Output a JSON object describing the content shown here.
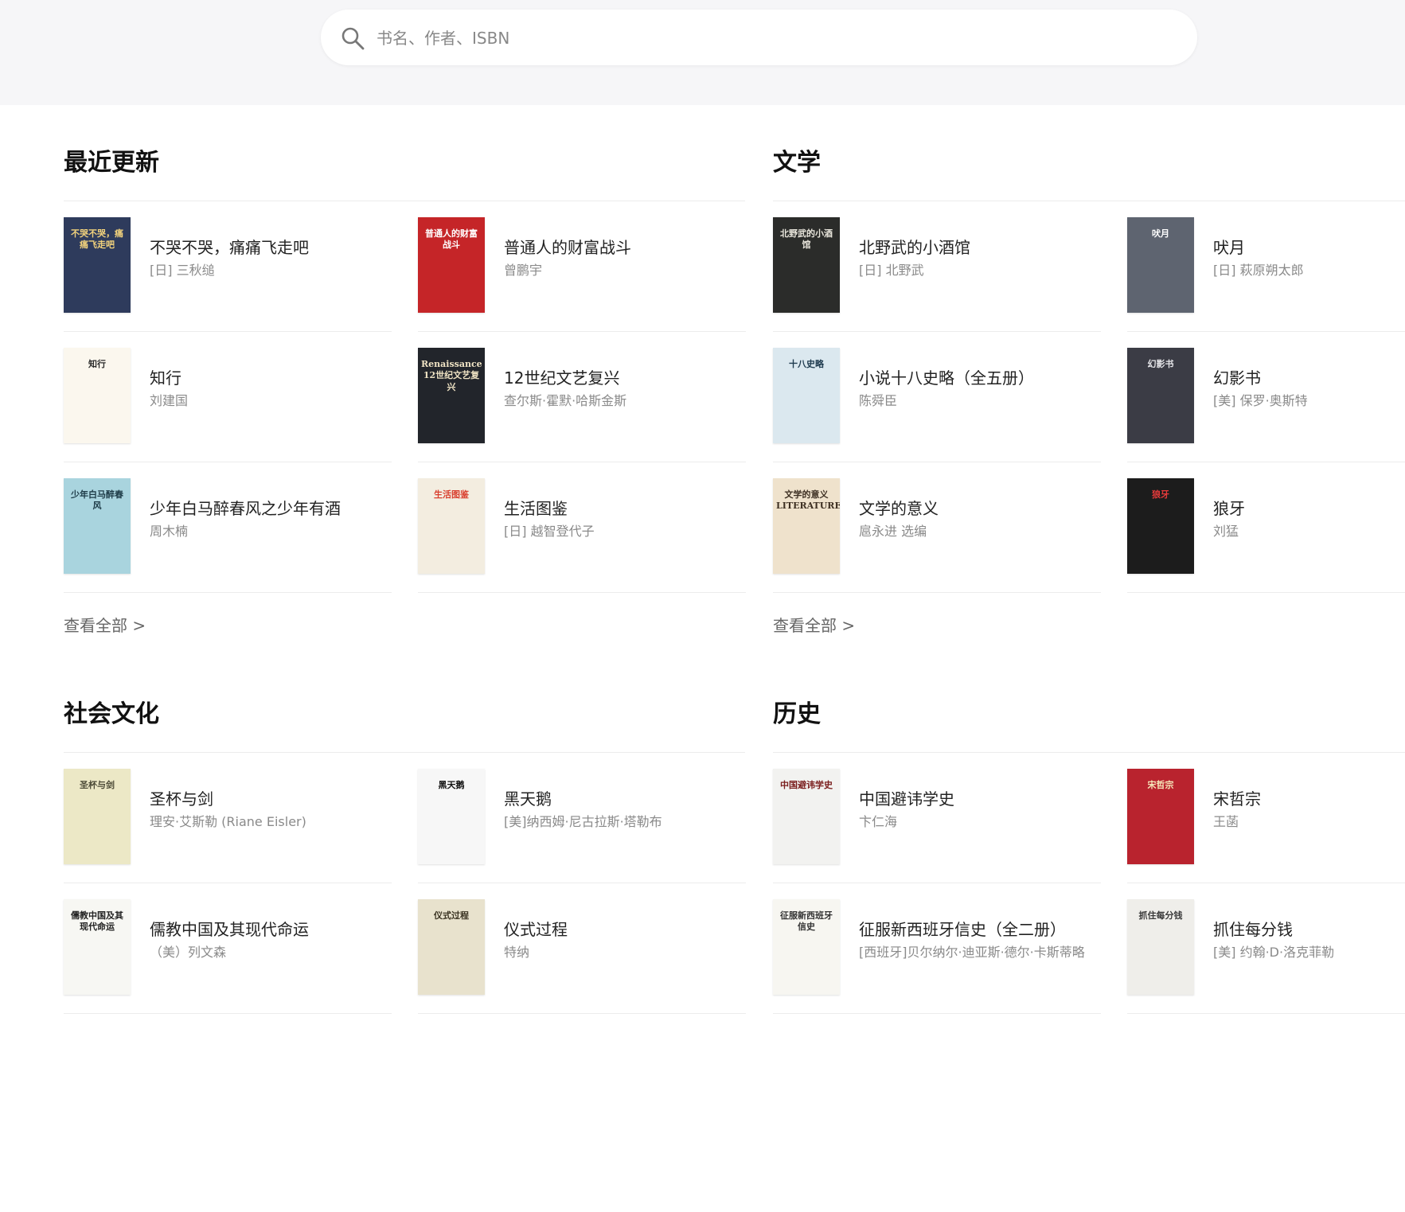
{
  "search": {
    "placeholder": "书名、作者、ISBN"
  },
  "sections": [
    {
      "title": "最近更新",
      "view_all": "查看全部 >",
      "books": [
        {
          "title": "不哭不哭，痛痛飞走吧",
          "author": "[日] 三秋缒",
          "cover_bg": "#2e3b5c",
          "cover_fg": "#f2d27c",
          "cover_text": "不哭不哭，痛痛飞走吧"
        },
        {
          "title": "普通人的财富战斗",
          "author": "曾鹏宇",
          "cover_bg": "#c52528",
          "cover_fg": "#ffffff",
          "cover_text": "普通人的财富战斗"
        },
        {
          "title": "知行",
          "author": "刘建国",
          "cover_bg": "#fbf7ee",
          "cover_fg": "#2a2a2a",
          "cover_text": "知行"
        },
        {
          "title": "12世纪文艺复兴",
          "author": "查尔斯·霍默·哈斯金斯",
          "cover_bg": "#22252b",
          "cover_fg": "#efe3c4",
          "cover_text": "Renaissance 12世纪文艺复兴"
        },
        {
          "title": "少年白马醉春风之少年有酒",
          "author": "周木楠",
          "cover_bg": "#a9d4de",
          "cover_fg": "#1d3a46",
          "cover_text": "少年白马醉春风"
        },
        {
          "title": "生活图鉴",
          "author": "[日] 越智登代子",
          "cover_bg": "#f3ede0",
          "cover_fg": "#d93f2e",
          "cover_text": "生活图鉴"
        }
      ]
    },
    {
      "title": "文学",
      "view_all": "查看全部 >",
      "books": [
        {
          "title": "北野武的小酒馆",
          "author": "[日] 北野武",
          "cover_bg": "#2b2c2a",
          "cover_fg": "#eae7dd",
          "cover_text": "北野武的小酒馆"
        },
        {
          "title": "吠月",
          "author": "[日] 萩原朔太郎",
          "cover_bg": "#5e6470",
          "cover_fg": "#ffffff",
          "cover_text": "吠月"
        },
        {
          "title": "小说十八史略（全五册）",
          "author": "陈舜臣",
          "cover_bg": "#dbe8ef",
          "cover_fg": "#1e3a4e",
          "cover_text": "十八史略"
        },
        {
          "title": "幻影书",
          "author": "[美] 保罗·奥斯特",
          "cover_bg": "#3b3c45",
          "cover_fg": "#e7e7ea",
          "cover_text": "幻影书"
        },
        {
          "title": "文学的意义",
          "author": "扈永进 选编",
          "cover_bg": "#efe2cc",
          "cover_fg": "#3d2f22",
          "cover_text": "文学的意义 LITERATURE"
        },
        {
          "title": "狼牙",
          "author": "刘猛",
          "cover_bg": "#1c1c1c",
          "cover_fg": "#e43a3a",
          "cover_text": "狼牙"
        }
      ]
    },
    {
      "title": "社会文化",
      "view_all": "",
      "books": [
        {
          "title": "圣杯与剑",
          "author": "理安·艾斯勒 (Riane Eisler)",
          "cover_bg": "#ece8c6",
          "cover_fg": "#4b4936",
          "cover_text": "圣杯与剑"
        },
        {
          "title": "黑天鹅",
          "author": "[美]纳西姆·尼古拉斯·塔勒布",
          "cover_bg": "#f7f7f7",
          "cover_fg": "#111111",
          "cover_text": "黑天鹅"
        },
        {
          "title": "儒教中国及其现代命运",
          "author": "（美）列文森",
          "cover_bg": "#f7f7f3",
          "cover_fg": "#222222",
          "cover_text": "儒教中国及其现代命运"
        },
        {
          "title": "仪式过程",
          "author": "特纳",
          "cover_bg": "#e8e2cd",
          "cover_fg": "#3a3322",
          "cover_text": "仪式过程"
        }
      ]
    },
    {
      "title": "历史",
      "view_all": "",
      "books": [
        {
          "title": "中国避讳学史",
          "author": "卞仁海",
          "cover_bg": "#f2f2f0",
          "cover_fg": "#7a1d1d",
          "cover_text": "中国避讳学史"
        },
        {
          "title": "宋哲宗",
          "author": "王菡",
          "cover_bg": "#b9232e",
          "cover_fg": "#f5e5b9",
          "cover_text": "宋哲宗"
        },
        {
          "title": "征服新西班牙信史（全二册）",
          "author": "[西班牙]贝尔纳尔·迪亚斯·德尔·卡斯蒂略",
          "cover_bg": "#f7f6f1",
          "cover_fg": "#333333",
          "cover_text": "征服新西班牙信史"
        },
        {
          "title": "抓住每分钱",
          "author": "[美] 约翰·D·洛克菲勒",
          "cover_bg": "#efeeea",
          "cover_fg": "#3a3a3a",
          "cover_text": "抓住每分钱"
        }
      ]
    }
  ]
}
